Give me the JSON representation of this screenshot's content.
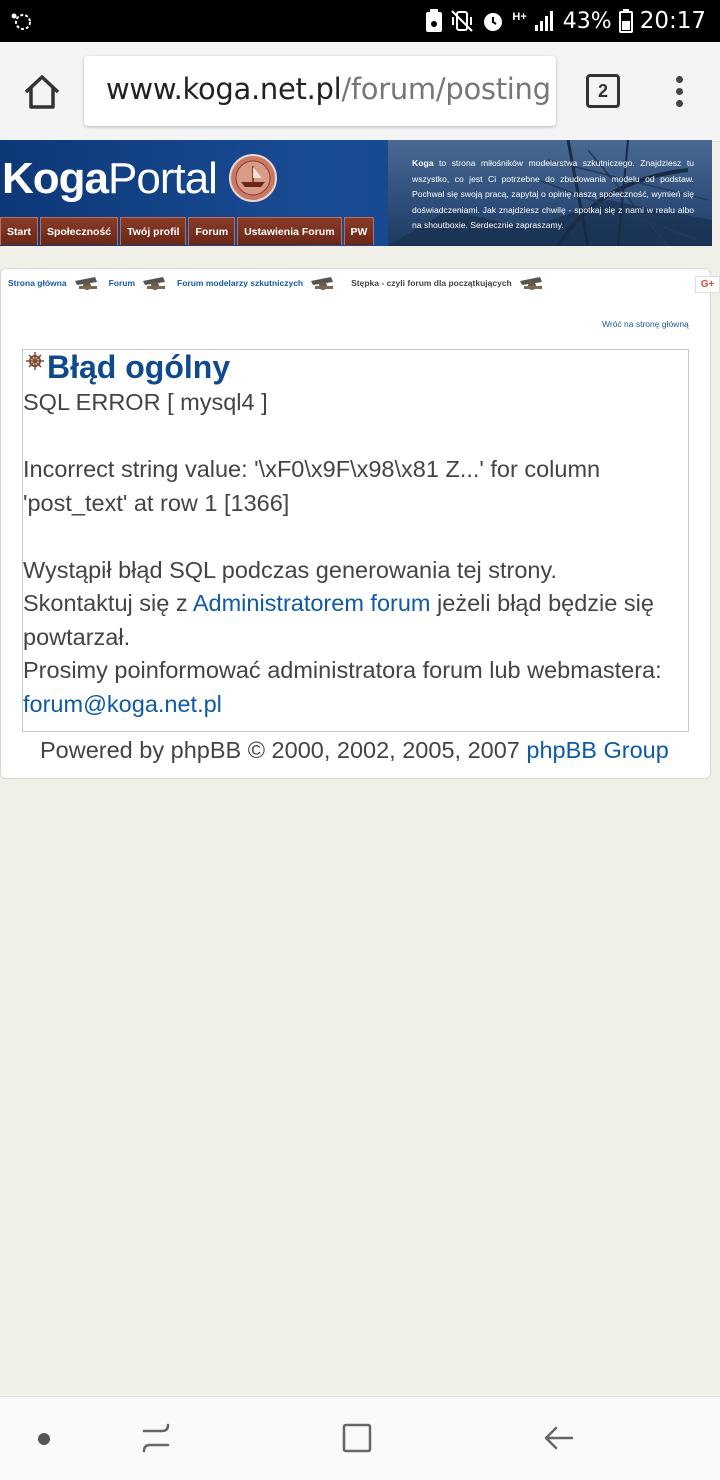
{
  "status_bar": {
    "battery_percent": "43%",
    "time": "20:17",
    "network": "H+",
    "icons": [
      "cast-icon",
      "save-icon",
      "mute-vibrate-icon",
      "alarm-icon",
      "data-icon",
      "signal-icon",
      "battery-icon"
    ]
  },
  "browser": {
    "url_host": "www.koga.net.pl",
    "url_path": "/forum/posting",
    "tab_count": "2"
  },
  "site": {
    "logo_koga": "Koga",
    "logo_portal": "Portal",
    "header_bold": "Koga",
    "header_text": " to strona miłośników modelarstwa szkutniczego. Znajdziesz tu wszystko, co jest Ci potrzebne do zbudowania modelu od podstaw. Pochwal się swoją pracą, zapytaj o opinię naszą społeczność, wymień się doświadczeniami. Jak znajdziesz chwilę - spotkaj się z nami w realu albo na shoutboxie. Serdecznie zapraszamy.",
    "nav": [
      {
        "label": "Start"
      },
      {
        "label": "Społeczność"
      },
      {
        "label": "Twój profil"
      },
      {
        "label": "Forum"
      },
      {
        "label": "Ustawienia Forum"
      },
      {
        "label": "PW"
      }
    ]
  },
  "breadcrumb": {
    "items": [
      "Strona główna",
      "Forum",
      "Forum modelarzy szkutniczych",
      "Stępka - czyli forum dla początkujących"
    ]
  },
  "gplus_label": "G+",
  "back_link": "Wróć na stronę główną",
  "error": {
    "title": "Błąd ogólny",
    "sql_error": "SQL ERROR [ mysql4 ]",
    "message": "Incorrect string value: '\\xF0\\x9F\\x98\\x81 Z...' for column 'post_text' at row 1 [1366]",
    "desc_1": "Wystąpił błąd SQL podczas generowania tej strony.",
    "desc_2a": "Skontaktuj się z ",
    "desc_2_link": "Administratorem forum",
    "desc_2b": " jeżeli błąd będzie się powtarzał.",
    "desc_3": "Prosimy poinformować administratora forum lub webmastera: ",
    "desc_3_link": "forum@koga.net.pl"
  },
  "footer": {
    "powered": "Powered by phpBB © 2000, 2002, 2005, 2007 ",
    "phpbb_link": "phpBB Group"
  }
}
